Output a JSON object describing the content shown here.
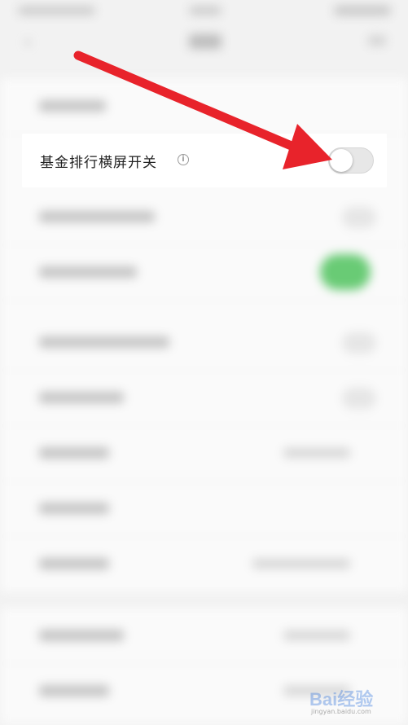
{
  "setting": {
    "label": "基金排行横屏开关",
    "toggle_state": "off"
  },
  "watermark": {
    "brand": "Bai经验",
    "url": "jingyan.baidu.com"
  },
  "colors": {
    "arrow": "#e8232b",
    "toggle_on": "#4fc25d",
    "toggle_off": "#e7e7e7"
  }
}
